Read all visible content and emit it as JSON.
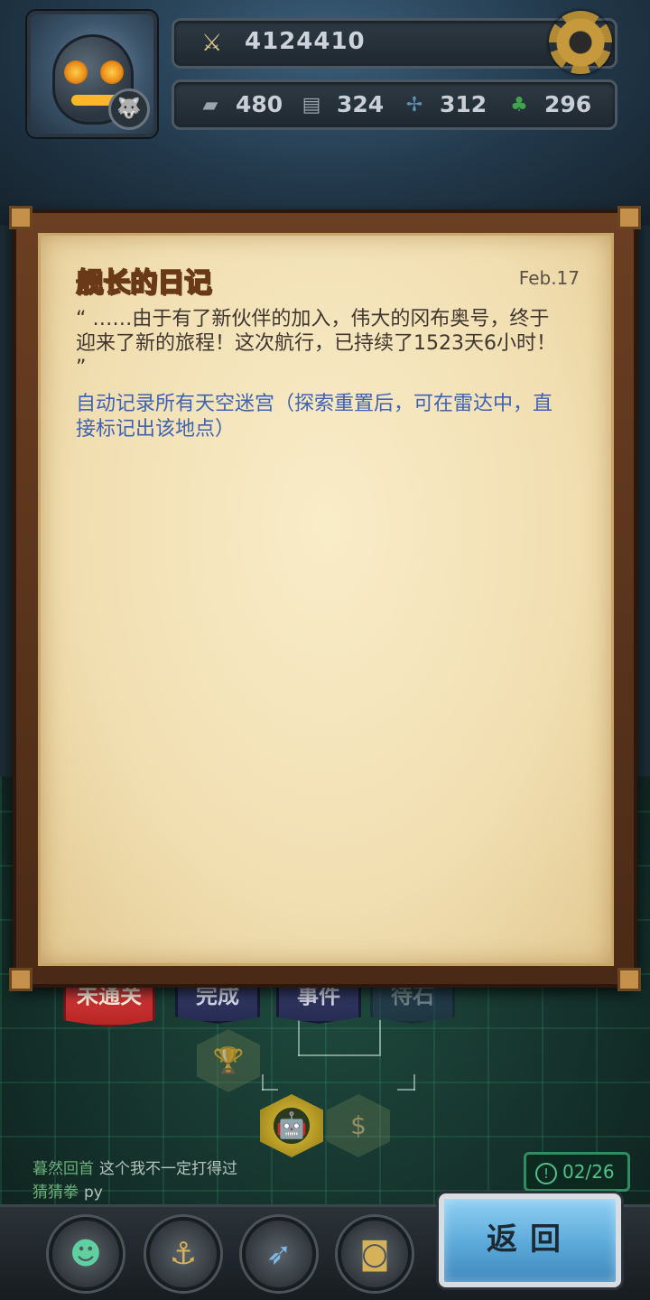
{
  "header": {
    "power": "4124410",
    "resources": [
      {
        "icon": "tank-icon",
        "value": "480"
      },
      {
        "icon": "chip-icon",
        "value": "324"
      },
      {
        "icon": "fan-icon",
        "value": "312"
      },
      {
        "icon": "clover-icon",
        "value": "296"
      }
    ]
  },
  "diary": {
    "title": "舰长的日记",
    "date": "Feb.17",
    "quote": "“ ……由于有了新伙伴的加入，伟大的冈布奥号，终于迎来了新的旅程！这次航行，已持续了1523天6小时！ ”",
    "note": "自动记录所有天空迷宫（探索重置后，可在雷达中，直接标记出该地点）"
  },
  "tabs": [
    {
      "label": "未通关"
    },
    {
      "label": "完成"
    },
    {
      "label": "事件"
    },
    {
      "label": "待石"
    }
  ],
  "chat": [
    {
      "name": "暮然回首",
      "message": "这个我不一定打得过"
    },
    {
      "name": "猜猜拳",
      "message": "py"
    }
  ],
  "counter": "02/26",
  "return_label": "返回",
  "colors": {
    "paper": "#f1dfb2",
    "title": "#f6d58b",
    "note_text": "#3f62b4",
    "active_tab": "#e24444",
    "return_button": "#5ba9d9"
  }
}
